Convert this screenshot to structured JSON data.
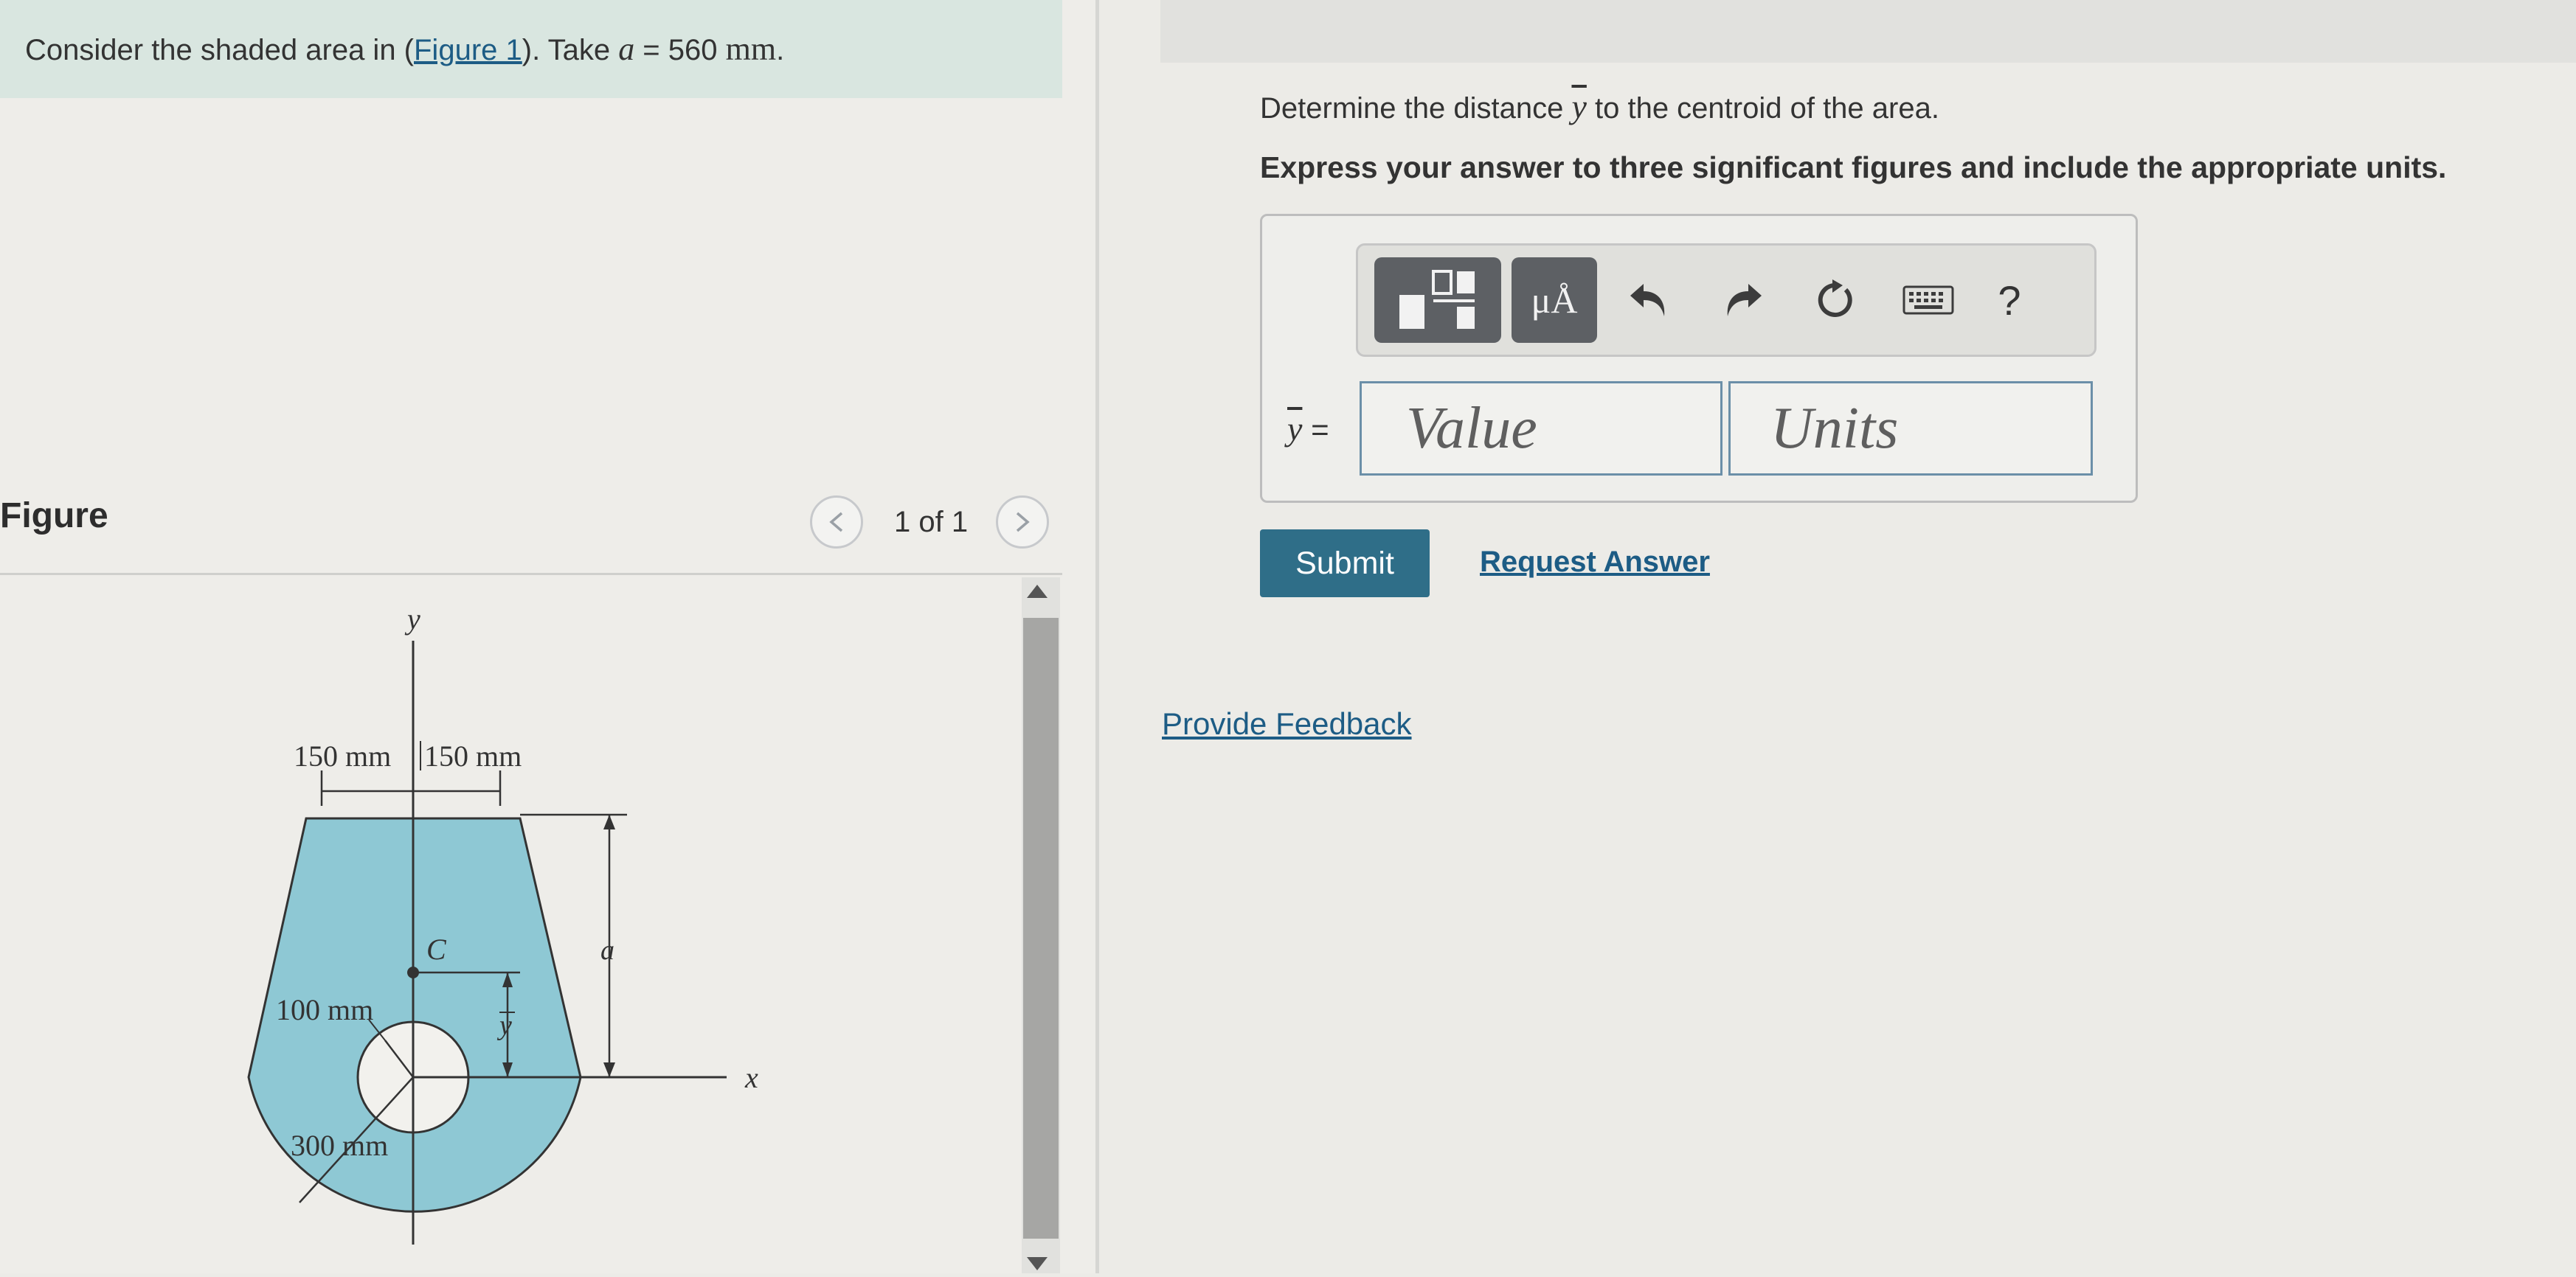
{
  "prompt": {
    "text_before": "Consider the shaded area in (",
    "figure_link": "Figure 1",
    "text_mid": "). Take ",
    "var_a": "a",
    "eq": " = 560 ",
    "unit": "mm",
    "period": "."
  },
  "figure_panel": {
    "title": "Figure",
    "pager_text": "1 of 1",
    "prev_icon": "chevron-left",
    "next_icon": "chevron-right"
  },
  "figure": {
    "label_y": "y",
    "label_x": "x",
    "dim_left": "150 mm",
    "dim_right": "150 mm",
    "label_a": "a",
    "label_c": "C",
    "label_ybar": "y",
    "label_100": "100 mm",
    "label_300": "300 mm",
    "fill_color": "#8ec8d4"
  },
  "question": {
    "line1_before": "Determine the distance ",
    "line1_var": "y",
    "line1_after": " to the centroid of the area.",
    "line2": "Express your answer to three significant figures and include the appropriate units."
  },
  "toolbar": {
    "template_icon": "fraction-template",
    "units_label": "μÅ",
    "undo_icon": "undo",
    "redo_icon": "redo",
    "reset_icon": "reset",
    "keyboard_icon": "keyboard",
    "help_label": "?"
  },
  "answer": {
    "ybar_var": "y",
    "ybar_eq": " =",
    "value_placeholder": "Value",
    "units_placeholder": "Units"
  },
  "actions": {
    "submit": "Submit",
    "request": "Request Answer",
    "feedback": "Provide Feedback"
  },
  "colors": {
    "submit_bg": "#2f6e88",
    "link": "#1d5c85",
    "prompt_bg": "#d9e6e0"
  }
}
